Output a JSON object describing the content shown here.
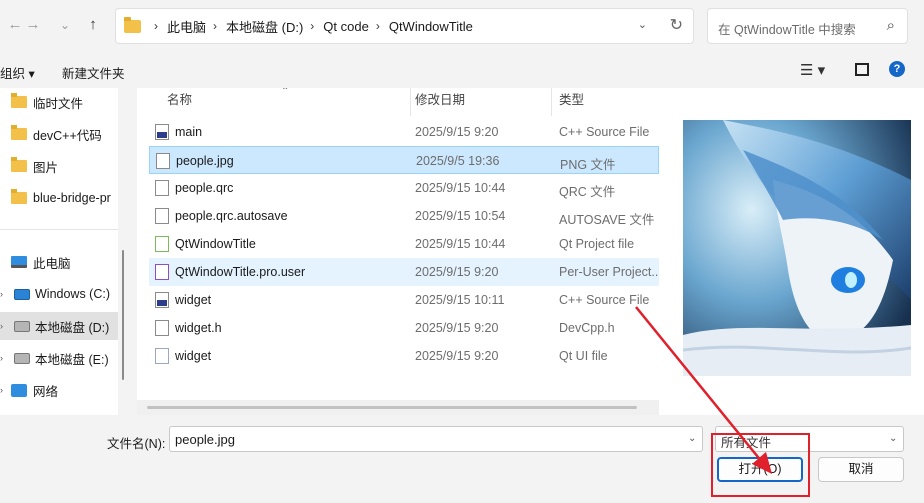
{
  "nav": {
    "back_icon": "←",
    "forward_icon": "→",
    "history_icon": "⌄",
    "up_icon": "↑"
  },
  "address": {
    "crumbs": [
      "此电脑",
      "本地磁盘 (D:)",
      "Qt code",
      "QtWindowTitle"
    ],
    "refresh_icon": "↻",
    "dropdown_icon": "⌄"
  },
  "search": {
    "placeholder": "在 QtWindowTitle 中搜索",
    "icon": "⌕"
  },
  "toolbar": {
    "organize": "组织 ▾",
    "new_folder": "新建文件夹",
    "view_icon": "☰ ▾",
    "help_icon": "?"
  },
  "sidebar": {
    "items": [
      {
        "label": "临时文件",
        "icon": "folder-icon"
      },
      {
        "label": "devC++代码",
        "icon": "folder-icon"
      },
      {
        "label": "图片",
        "icon": "folder-icon"
      },
      {
        "label": "blue-bridge-pr",
        "icon": "folder-icon"
      },
      {
        "label": "此电脑",
        "icon": "computer-icon"
      },
      {
        "label": "Windows (C:)",
        "icon": "drive-icon"
      },
      {
        "label": "本地磁盘 (D:)",
        "icon": "drive-icon"
      },
      {
        "label": "本地磁盘 (E:)",
        "icon": "drive-icon"
      },
      {
        "label": "网络",
        "icon": "network-icon"
      }
    ]
  },
  "columns": {
    "name": "名称",
    "date": "修改日期",
    "type": "类型"
  },
  "files": [
    {
      "name": "main",
      "date": "2025/9/15 9:20",
      "type": "C++ Source File",
      "icon": "cpp"
    },
    {
      "name": "people.jpg",
      "date": "2025/9/5 19:36",
      "type": "PNG 文件",
      "icon": "doc"
    },
    {
      "name": "people.qrc",
      "date": "2025/9/15 10:44",
      "type": "QRC 文件",
      "icon": "doc"
    },
    {
      "name": "people.qrc.autosave",
      "date": "2025/9/15 10:54",
      "type": "AUTOSAVE 文件",
      "icon": "doc"
    },
    {
      "name": "QtWindowTitle",
      "date": "2025/9/15 10:44",
      "type": "Qt Project file",
      "icon": "pro"
    },
    {
      "name": "QtWindowTitle.pro.user",
      "date": "2025/9/15 9:20",
      "type": "Per-User Project...",
      "icon": "user"
    },
    {
      "name": "widget",
      "date": "2025/9/15 10:11",
      "type": "C++ Source File",
      "icon": "cpp"
    },
    {
      "name": "widget.h",
      "date": "2025/9/15 9:20",
      "type": "DevCpp.h",
      "icon": "doc"
    },
    {
      "name": "widget",
      "date": "2025/9/15 9:20",
      "type": "Qt UI file",
      "icon": "ui"
    }
  ],
  "bottom": {
    "filename_label": "文件名(N):",
    "filename_value": "people.jpg",
    "filetype_value": "所有文件",
    "open_button": "打开(O)",
    "cancel_button": "取消"
  },
  "colors": {
    "accent": "#1467c7",
    "annotation": "#e0202a",
    "selected_row": "#cce8ff"
  }
}
